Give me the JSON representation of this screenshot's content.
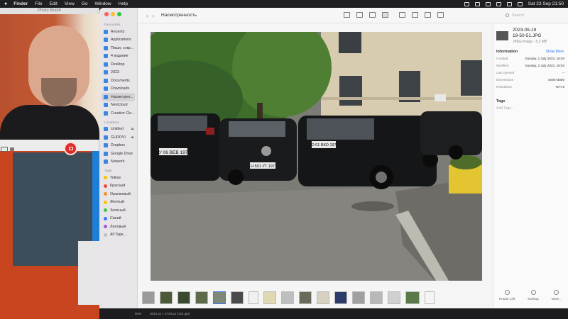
{
  "menubar": {
    "app": "Finder",
    "items": [
      "File",
      "Edit",
      "View",
      "Go",
      "Window",
      "Help"
    ],
    "datetime": "Sat 23 Sep  21:50"
  },
  "photobooth": {
    "title": "Photo Booth"
  },
  "finder": {
    "title": "Насмотренность",
    "search_placeholder": "Search",
    "sidebar": {
      "favorites_header": "Favourites",
      "favorites": [
        {
          "label": "Recents",
          "icon": "clock-icon"
        },
        {
          "label": "Applications",
          "icon": "applications-icon"
        },
        {
          "label": "Пиши, сокр...",
          "icon": "folder-icon"
        },
        {
          "label": "4 издание",
          "icon": "folder-icon"
        },
        {
          "label": "Desktop",
          "icon": "desktop-icon"
        },
        {
          "label": "2023",
          "icon": "folder-icon"
        },
        {
          "label": "Documents",
          "icon": "document-icon"
        },
        {
          "label": "Downloads",
          "icon": "download-icon"
        },
        {
          "label": "Насмотрен...",
          "icon": "folder-icon"
        },
        {
          "label": "Nextcloud",
          "icon": "cloud-icon"
        },
        {
          "label": "Creative Clo...",
          "icon": "document-icon"
        }
      ],
      "locations_header": "Locations",
      "locations": [
        {
          "label": "Untitled",
          "icon": "disk-icon"
        },
        {
          "label": "GUROVI",
          "icon": "disk-icon"
        },
        {
          "label": "Dropbox",
          "icon": "dropbox-icon"
        },
        {
          "label": "Google Drive",
          "icon": "drive-icon"
        },
        {
          "label": "Network",
          "icon": "network-icon"
        }
      ],
      "tags_header": "Tags",
      "tags": [
        {
          "label": "Yellow",
          "color": "#f5c400"
        },
        {
          "label": "Красный",
          "color": "#f2483c"
        },
        {
          "label": "Оранжевый",
          "color": "#f5902a"
        },
        {
          "label": "Желтый",
          "color": "#f5c400"
        },
        {
          "label": "Зеленый",
          "color": "#3cc24c"
        },
        {
          "label": "Синий",
          "color": "#3478f6"
        },
        {
          "label": "Лиловый",
          "color": "#a35bd6"
        },
        {
          "label": "All Tags...",
          "color": "#bdbdbd"
        }
      ]
    },
    "info_panel": {
      "file_name_line1": "2023-05-19",
      "file_name_line2": "19-50-51.JPG",
      "file_meta": "JPEG image - 5,2 MB",
      "information_header": "Information",
      "show_more": "Show More",
      "rows": [
        {
          "k": "Created",
          "v": "Sunday, 2 July 2023, 18:04"
        },
        {
          "k": "Modified",
          "v": "Sunday, 2 July 2023, 18:04"
        },
        {
          "k": "Last opened",
          "v": "--"
        },
        {
          "k": "Dimensions",
          "v": "4000×3000"
        },
        {
          "k": "Resolution",
          "v": "72×72"
        }
      ],
      "tags_header": "Tags",
      "add_tags": "Add Tags..."
    },
    "actions": [
      "Rotate Left",
      "Markup",
      "More..."
    ],
    "status": {
      "zoom": "50%",
      "dims": "2024 px × 2734 px (144 ppi)"
    },
    "plates": [
      "У 06 ВЕВ 197",
      "Н 591 УТ 197",
      "О 01 ВКО 197"
    ]
  }
}
